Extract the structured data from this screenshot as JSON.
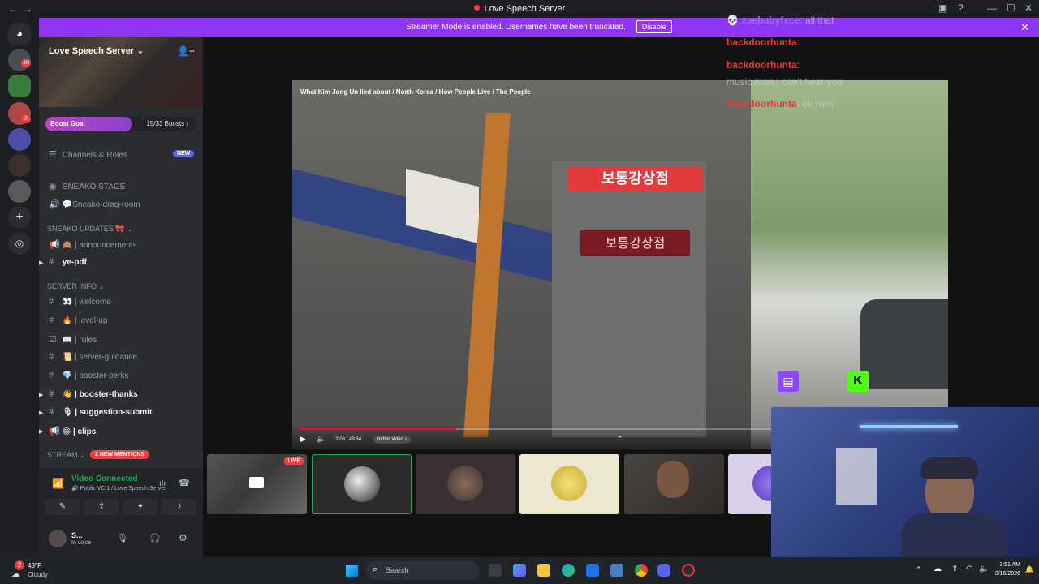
{
  "window": {
    "title": "Love Speech Server"
  },
  "banner": {
    "text": "Streamer Mode is enabled. Usernames have been truncated.",
    "disable_label": "Disable"
  },
  "rail": {
    "badges": [
      "10",
      "2"
    ]
  },
  "sidebar": {
    "server_name": "Love Speech Server",
    "boost": {
      "label": "Boost Goal",
      "count": "19/33 Boosts",
      "fraction": 0.576
    },
    "channels_roles": "Channels & Roles",
    "new_badge": "NEW",
    "stage_channel": "SNEAKO STAGE",
    "drag_room": "💬Sneako-drag-room",
    "category_updates": "SNEAKO UPDATES 🎀",
    "announcements": "| announcements",
    "ye_pdf": "ye-pdf",
    "category_info": "SERVER INFO",
    "info_channels": [
      {
        "emoji": "👀",
        "label": "| welcome"
      },
      {
        "emoji": "🔥",
        "label": "| level-up"
      },
      {
        "emoji": "📖",
        "label": "| rules"
      },
      {
        "emoji": "📜",
        "label": "| server-guidance"
      },
      {
        "emoji": "💎",
        "label": "| booster-perks"
      }
    ],
    "booster_thanks": "| booster-thanks",
    "suggestion_submit": "| suggestion-submit",
    "clips": "| clips",
    "category_stream": "STREAM",
    "mentions_badge": "2 NEW MENTIONS"
  },
  "voice": {
    "status": "Video Connected",
    "channel": "Public VC 1 / Love Speech Server",
    "user_name": "S...",
    "user_status": "In voice"
  },
  "video": {
    "title": "What Kim Jong Un lied about / North Korea / How People Live / The People",
    "time": "12:08 / 49:34",
    "chapter": "In this video",
    "progress": 0.245,
    "sign_text": "보통강상점"
  },
  "chat": [
    {
      "user": "xaebabyfxce",
      "msg": ": all that",
      "color": "purple"
    },
    {
      "user": "backdoorhunta",
      "msg": ":",
      "color": "red"
    },
    {
      "user": "backdoorhunta",
      "msg": ":",
      "color": "red"
    },
    {
      "user": "",
      "msg": "music man I can't hear you",
      "color": "none"
    },
    {
      "user": "backdoorhunta",
      "msg": ": ok nvm",
      "color": "red"
    }
  ],
  "tiles": {
    "live_label": "LIVE"
  },
  "taskbar": {
    "temp": "48°F",
    "weather": "Cloudy",
    "search": "Search",
    "time": "3:51 AM",
    "date": "3/16/2026",
    "notif_badge": "2"
  }
}
